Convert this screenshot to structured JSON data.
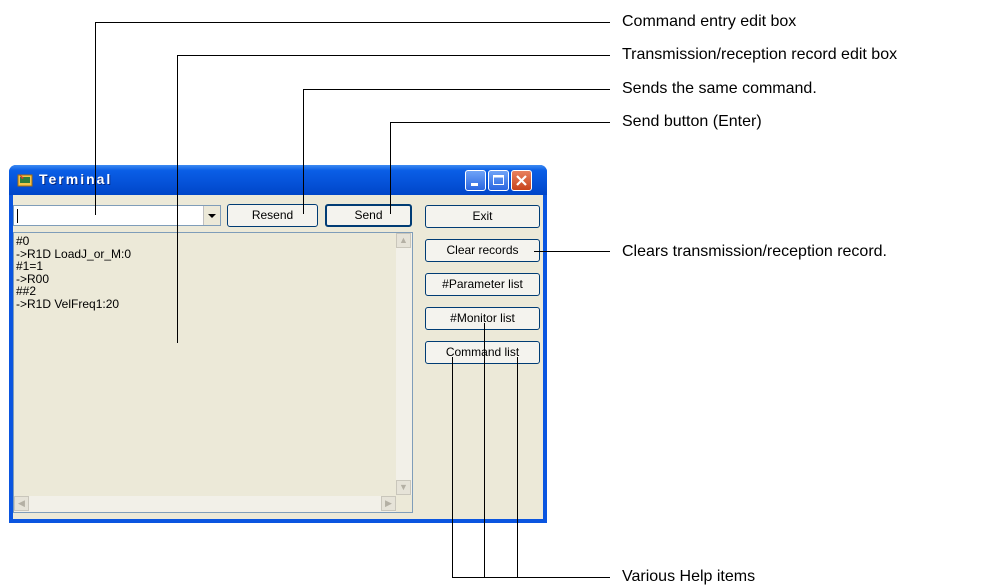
{
  "window": {
    "title": "Terminal",
    "command_input": {
      "value": ""
    },
    "buttons": {
      "resend": "Resend",
      "send": "Send",
      "exit": "Exit",
      "clear_records": "Clear records",
      "parameter_list": "#Parameter list",
      "monitor_list": "#Monitor list",
      "command_list": "Command list"
    },
    "record_lines": [
      "#0",
      "->R1D LoadJ_or_M:0",
      "#1=1",
      "->R00",
      "##2",
      "->R1D VelFreq1:20"
    ]
  },
  "annotations": {
    "command_entry": "Command entry edit box",
    "record_box": "Transmission/reception record edit box",
    "resend": "Sends the same command.",
    "send": "Send button (Enter)",
    "clear": "Clears transmission/reception record.",
    "help": "Various Help items"
  },
  "colors": {
    "title_bar": "#0a55e0",
    "dialog_face": "#ece9d8",
    "close_button": "#c7431c"
  }
}
